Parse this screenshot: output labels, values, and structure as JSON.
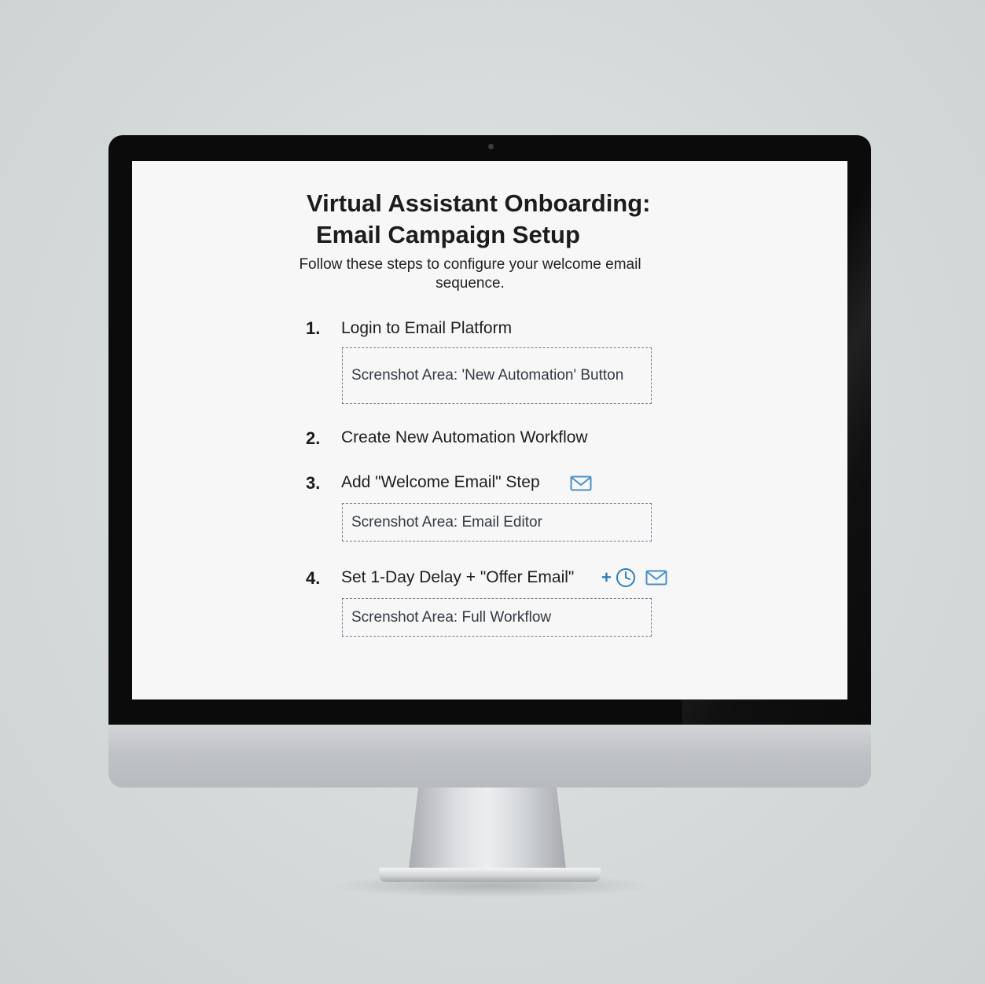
{
  "page": {
    "title_line1": "Virtual Assistant Onboarding:",
    "title_line2": "Email Campaign Setup",
    "subtitle": "Follow these steps to configure your welcome email sequence."
  },
  "steps": [
    {
      "number": "1.",
      "label": "Login to Email Platform",
      "screenshot_area": "Screnshot Area: 'New Automation' Button",
      "icons": []
    },
    {
      "number": "2.",
      "label": "Create New Automation Workflow",
      "icons": []
    },
    {
      "number": "3.",
      "label": "Add \"Welcome Email\" Step",
      "screenshot_area": "Screnshot Area: Email Editor",
      "icons": [
        "envelope-icon"
      ]
    },
    {
      "number": "4.",
      "label": "Set 1-Day Delay + \"Offer Email\"",
      "plus": "+",
      "screenshot_area": "Screnshot Area: Full Workflow",
      "icons": [
        "clock-icon",
        "envelope-icon"
      ]
    }
  ],
  "colors": {
    "accent": "#2d7fc1",
    "icon_blue": "#4a8fc9",
    "dashed_border": "#6f7f95"
  }
}
